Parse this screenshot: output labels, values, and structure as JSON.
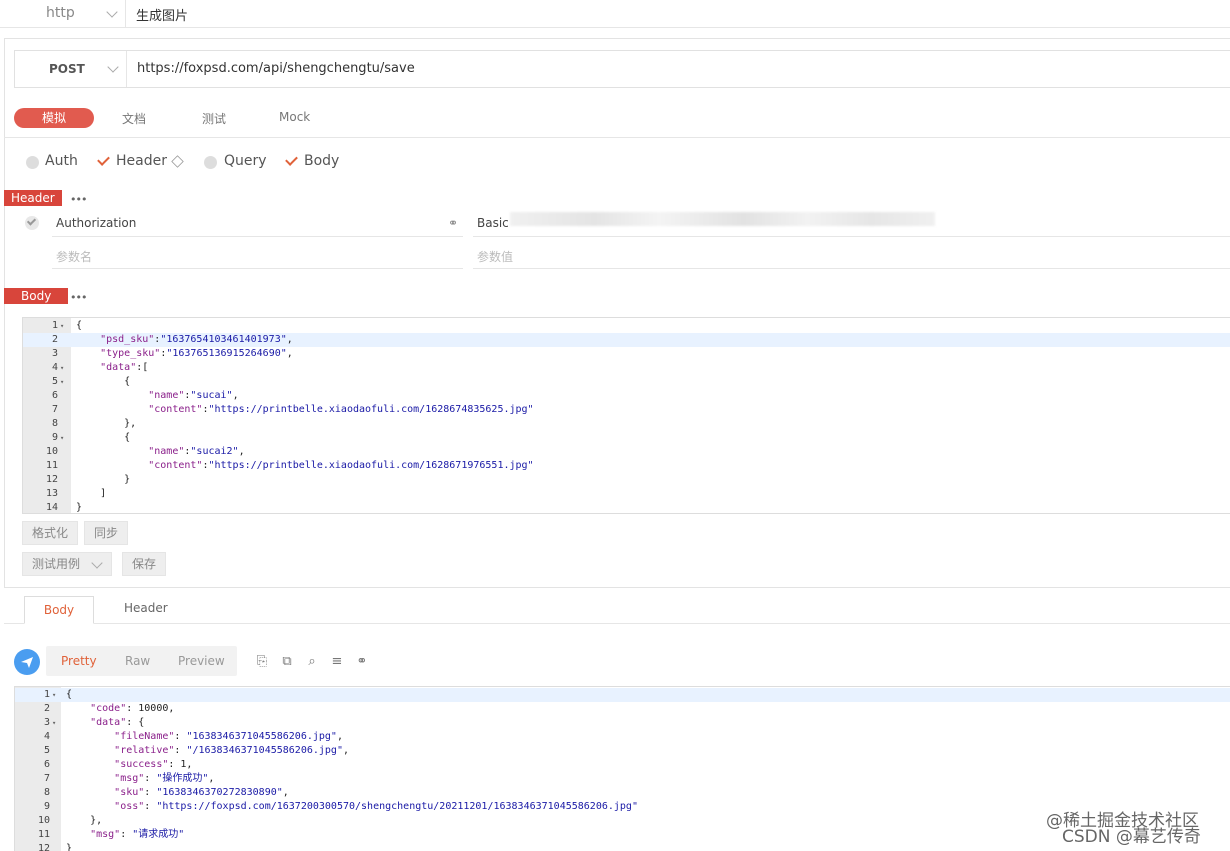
{
  "top": {
    "protocol": "http",
    "name": "生成图片"
  },
  "request": {
    "method": "POST",
    "url": "https://foxpsd.com/api/shengchengtu/save"
  },
  "tabs": [
    "模拟",
    "文档",
    "测试",
    "Mock"
  ],
  "options": [
    {
      "label": "Auth",
      "checked": false
    },
    {
      "label": "Header",
      "checked": true
    },
    {
      "label": "Query",
      "checked": false
    },
    {
      "label": "Body",
      "checked": true
    }
  ],
  "header_section": {
    "tag": "Header",
    "dots": "•••",
    "row": {
      "name": "Authorization",
      "value": "Basic"
    },
    "name_placeholder": "参数名",
    "value_placeholder": "参数值"
  },
  "body_section": {
    "tag": "Body",
    "dots": "•••"
  },
  "request_body_lines": [
    {
      "n": "1",
      "t": "{",
      "fold": true
    },
    {
      "n": "2",
      "t": "    \"psd_sku\":\"1637654103461401973\",",
      "fold": false,
      "hl": true
    },
    {
      "n": "3",
      "t": "    \"type_sku\":\"163765136915264690\",",
      "fold": false
    },
    {
      "n": "4",
      "t": "    \"data\":[",
      "fold": true
    },
    {
      "n": "5",
      "t": "        {",
      "fold": true
    },
    {
      "n": "6",
      "t": "            \"name\":\"sucai\",",
      "fold": false
    },
    {
      "n": "7",
      "t": "            \"content\":\"https://printbelle.xiaodaofuli.com/1628674835625.jpg\"",
      "fold": false
    },
    {
      "n": "8",
      "t": "        },",
      "fold": false
    },
    {
      "n": "9",
      "t": "        {",
      "fold": true
    },
    {
      "n": "10",
      "t": "            \"name\":\"sucai2\",",
      "fold": false
    },
    {
      "n": "11",
      "t": "            \"content\":\"https://printbelle.xiaodaofuli.com/1628671976551.jpg\"",
      "fold": false
    },
    {
      "n": "12",
      "t": "        }",
      "fold": false
    },
    {
      "n": "13",
      "t": "    ]",
      "fold": false
    },
    {
      "n": "14",
      "t": "}",
      "fold": false
    }
  ],
  "buttons": {
    "format": "格式化",
    "sync": "同步",
    "testcase": "测试用例",
    "save": "保存"
  },
  "response": {
    "tabs": [
      "Body",
      "Header"
    ],
    "views": [
      "Pretty",
      "Raw",
      "Preview"
    ],
    "lines": [
      {
        "n": "1",
        "t": "{",
        "fold": true,
        "hl": true
      },
      {
        "n": "2",
        "t": "    \"code\": 10000,",
        "fold": false
      },
      {
        "n": "3",
        "t": "    \"data\": {",
        "fold": true
      },
      {
        "n": "4",
        "t": "        \"fileName\": \"1638346371045586206.jpg\",",
        "fold": false
      },
      {
        "n": "5",
        "t": "        \"relative\": \"/1638346371045586206.jpg\",",
        "fold": false
      },
      {
        "n": "6",
        "t": "        \"success\": 1,",
        "fold": false
      },
      {
        "n": "7",
        "t": "        \"msg\": \"操作成功\",",
        "fold": false
      },
      {
        "n": "8",
        "t": "        \"sku\": \"1638346370272830890\",",
        "fold": false
      },
      {
        "n": "9",
        "t": "        \"oss\": \"https://foxpsd.com/1637200300570/shengchengtu/20211201/1638346371045586206.jpg\"",
        "fold": false
      },
      {
        "n": "10",
        "t": "    },",
        "fold": false
      },
      {
        "n": "11",
        "t": "    \"msg\": \"请求成功\"",
        "fold": false
      },
      {
        "n": "12",
        "t": "}",
        "fold": false
      }
    ]
  },
  "watermark": {
    "line1": "@稀土掘金技术社区",
    "line2": "CSDN @幕艺传奇"
  },
  "colors": {
    "accent": "#e15b4f",
    "tag": "#d8453b",
    "send": "#4a9df0",
    "check": "#e0623a"
  }
}
